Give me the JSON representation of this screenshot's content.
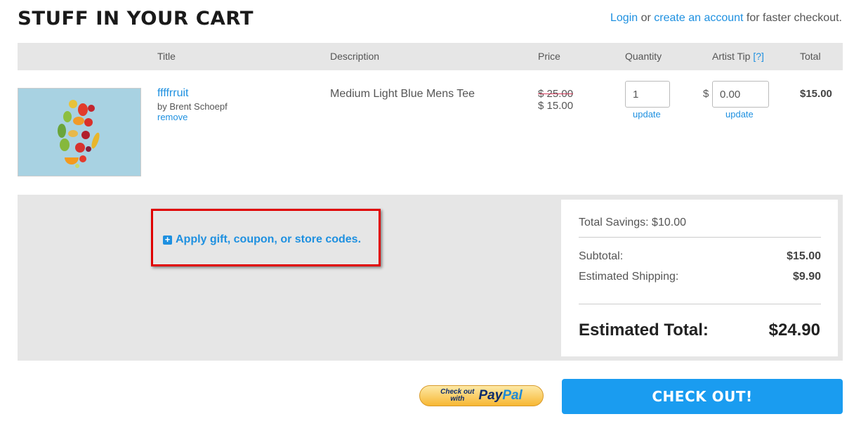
{
  "header": {
    "title": "STUFF IN YOUR CART",
    "login": "Login",
    "or": " or ",
    "create_account": "create an account",
    "suffix": " for faster checkout."
  },
  "table": {
    "headers": {
      "title": "Title",
      "description": "Description",
      "price": "Price",
      "quantity": "Quantity",
      "artist_tip": "Artist Tip",
      "artist_tip_help": "[?]",
      "total": "Total"
    },
    "item": {
      "name": "ffffrruit",
      "by": "by Brent Schoepf",
      "remove": "remove",
      "description": "Medium Light Blue Mens Tee",
      "price_old": "$ 25.00",
      "price_new": "$ 15.00",
      "quantity": "1",
      "update": "update",
      "tip_currency": "$",
      "tip": "0.00",
      "total": "$15.00"
    }
  },
  "coupon": {
    "plus": "+",
    "label": "Apply gift, coupon, or store codes."
  },
  "summary": {
    "savings": "Total Savings: $10.00",
    "subtotal_label": "Subtotal:",
    "subtotal": "$15.00",
    "shipping_label": "Estimated Shipping:",
    "shipping": "$9.90",
    "total_label": "Estimated Total:",
    "total": "$24.90"
  },
  "buttons": {
    "paypal_line1": "Check out",
    "paypal_line2": "with",
    "paypal_brand_a": "Pay",
    "paypal_brand_b": "Pal",
    "checkout": "CHECK OUT!"
  }
}
